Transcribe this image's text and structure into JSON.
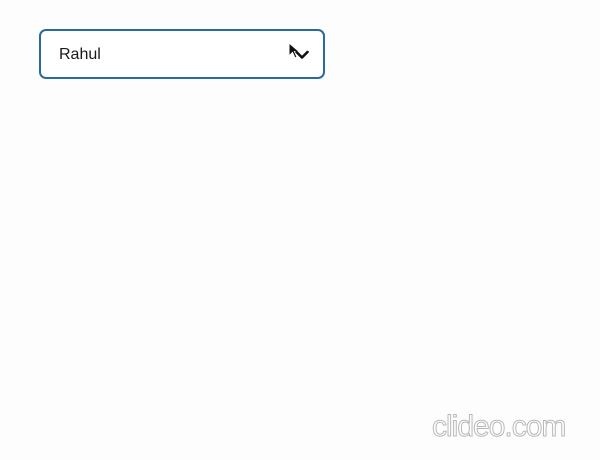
{
  "dropdown": {
    "selected_value": "Rahul",
    "border_color": "#2b6aa0",
    "icon": "chevron-down-icon"
  },
  "cursor": {
    "icon": "mouse-pointer-icon"
  },
  "watermark": {
    "text": "clideo.com"
  }
}
